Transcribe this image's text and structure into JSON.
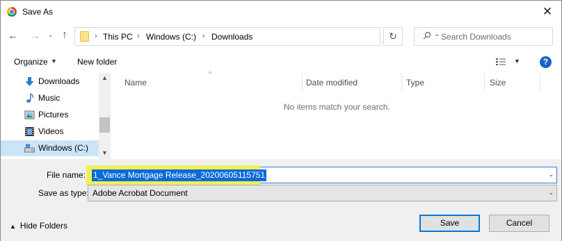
{
  "window": {
    "title": "Save As",
    "close_glyph": "✕"
  },
  "nav": {
    "back_glyph": "←",
    "forward_glyph": "→",
    "recent_glyph": "⌄",
    "up_glyph": "↑",
    "breadcrumbs": [
      "This PC",
      "Windows (C:)",
      "Downloads"
    ],
    "separator": "›",
    "dropdown_glyph": "⌄",
    "refresh_glyph": "↻",
    "search_placeholder": "Search Downloads"
  },
  "toolbar": {
    "organize_label": "Organize",
    "caret": "▼",
    "new_folder_label": "New folder",
    "help_glyph": "?"
  },
  "sidebar": {
    "items": [
      {
        "label": "Downloads",
        "icon": "download-icon"
      },
      {
        "label": "Music",
        "icon": "music-icon"
      },
      {
        "label": "Pictures",
        "icon": "pictures-icon"
      },
      {
        "label": "Videos",
        "icon": "videos-icon"
      },
      {
        "label": "Windows (C:)",
        "icon": "drive-icon",
        "selected": true
      }
    ],
    "scroll_up": "▲",
    "scroll_down": "▼"
  },
  "filelist": {
    "columns": [
      "Name",
      "Date modified",
      "Type",
      "Size"
    ],
    "sort_caret": "^",
    "empty_message": "No items match your search."
  },
  "form": {
    "filename_label": "File name:",
    "filename_value": "1_Vance Mortgage Release_20200605115751",
    "type_label": "Save as type:",
    "type_value": "Adobe Acrobat Document",
    "dropdown_glyph": "⌄"
  },
  "footer": {
    "hide_folders_label": "Hide Folders",
    "hide_caret": "▲",
    "save_label": "Save",
    "cancel_label": "Cancel"
  },
  "colors": {
    "accent": "#0078d7",
    "selection": "#0b6bd8",
    "highlight": "#f0f05a",
    "nav_selected": "#cce4f7"
  }
}
